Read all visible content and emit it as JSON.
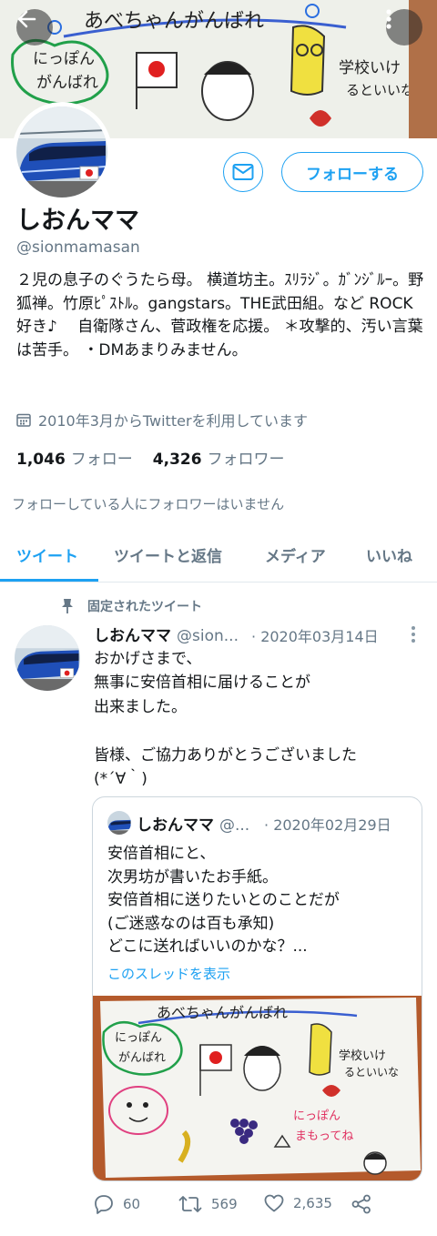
{
  "header": {
    "back_icon": "arrow-left-icon",
    "more_icon": "more-vertical-icon",
    "banner_drawing": {
      "top_text": "あべちゃんがんばれ",
      "left_text_1": "にっぽん",
      "left_text_2": "がんばれ",
      "right_text_1": "学校いけ",
      "right_text_2": "るといいな"
    }
  },
  "profile": {
    "display_name": "しおんママ",
    "handle": "@sionmamasan",
    "bio": "２児の息子のぐうたら母。 横道坊主。ｽﾘﾗｼﾞ。ｶﾞﾝｼﾞﾙｰ。野狐禅。竹原ﾋﾟｽﾄﾙ。gangstars。THE武田組。など ROCK好き♪　 自衛隊さん、菅政権を応援。 ＊攻撃的、汚い言葉は苦手。 ・DMあまりみません。",
    "joined": "2010年3月からTwitterを利用しています",
    "following_count": "1,046",
    "following_label": "フォロー",
    "followers_count": "4,326",
    "followers_label": "フォロワー",
    "mutual_note": "フォローしている人にフォロワーはいません",
    "message_icon": "mail-icon",
    "follow_label": "フォローする"
  },
  "tabs": [
    {
      "label": "ツイート",
      "active": true
    },
    {
      "label": "ツイートと返信",
      "active": false
    },
    {
      "label": "メディア",
      "active": false
    },
    {
      "label": "いいね",
      "active": false
    }
  ],
  "tweet": {
    "pinned_label": "固定されたツイート",
    "author_name": "しおんママ",
    "author_handle": "@sion...",
    "separator": "·",
    "date": "2020年03月14日",
    "body": "おかげさまで、\n無事に安倍首相に届けることが\n出来ました。\n\n皆様、ご協力ありがとうございました\n(*´∀｀)",
    "quote": {
      "author_name": "しおんママ",
      "author_handle": "@...",
      "separator": "·",
      "date": "2020年02月29日",
      "body": "安倍首相にと、\n次男坊が書いたお手紙。\n安倍首相に送りたいとのことだが\n(ご迷惑なのは百も承知)\nどこに送ればいいのかな？...",
      "thread_link": "このスレッドを表示",
      "image_drawing": {
        "top_text": "あべちゃんがんばれ",
        "left_text_1": "にっぽん",
        "left_text_2": "がんばれ",
        "right_text_1": "学校いけ",
        "right_text_2": "るといいな",
        "bottom_text_1": "にっぽん",
        "bottom_text_2": "まもってね"
      }
    },
    "actions": {
      "reply_count": "60",
      "retweet_count": "569",
      "like_count": "2,635"
    }
  },
  "colors": {
    "accent": "#1da1f2",
    "secondary_text": "#657786",
    "divider": "#e1e8ed"
  }
}
